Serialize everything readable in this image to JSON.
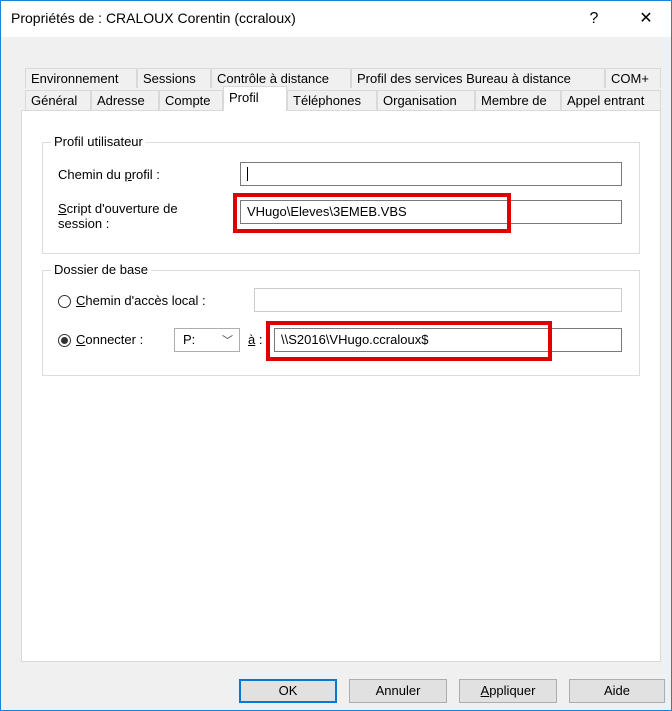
{
  "window": {
    "title": "Propriétés de : CRALOUX Corentin (ccraloux)",
    "help_glyph": "?",
    "close_glyph": "✕"
  },
  "tabs_row1": [
    "Environnement",
    "Sessions",
    "Contrôle à distance",
    "Profil des services Bureau à distance",
    "COM+"
  ],
  "tabs_row2": [
    "Général",
    "Adresse",
    "Compte",
    "Profil",
    "Téléphones",
    "Organisation",
    "Membre de",
    "Appel entrant"
  ],
  "active_tab": "Profil",
  "profile_group": {
    "legend": "Profil utilisateur",
    "profile_path_label_pre": "Chemin du ",
    "profile_path_label_u": "p",
    "profile_path_label_post": "rofil :",
    "profile_path_value": "",
    "script_label_u": "S",
    "script_label_post": "cript d'ouverture de",
    "script_label_line2": "session :",
    "script_value": "VHugo\\Eleves\\3EMEB.VBS"
  },
  "home_group": {
    "legend": "Dossier de base",
    "local_path_label_u": "C",
    "local_path_label_post": "hemin d'accès local :",
    "local_path_value": "",
    "local_path_selected": false,
    "connect_label_u": "C",
    "connect_label_post": "onnecter :",
    "connect_selected": true,
    "drive_value": "P:",
    "to_label_u": "à",
    "to_label_post": " :",
    "connect_path_value": "\\\\S2016\\VHugo.ccraloux$"
  },
  "buttons": {
    "ok": "OK",
    "cancel": "Annuler",
    "apply_u": "A",
    "apply_post": "ppliquer",
    "help": "Aide"
  },
  "colors": {
    "highlight_red": "#e00000",
    "focus_blue": "#0078d7"
  }
}
